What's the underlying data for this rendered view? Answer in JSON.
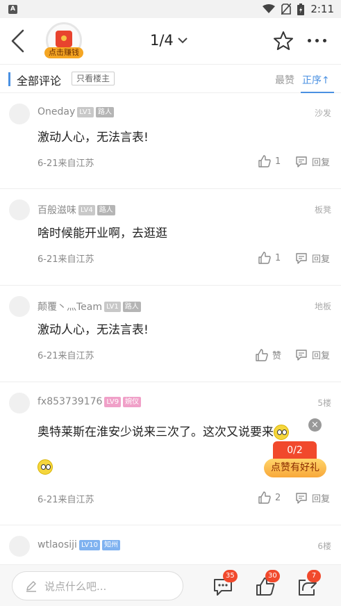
{
  "status_bar": {
    "time": "2:11",
    "app_badge": "A",
    "icons": [
      "wifi-icon",
      "no-sim-icon",
      "battery-icon"
    ]
  },
  "topbar": {
    "earn_label": "点击赚钱",
    "page_indicator": "1/4"
  },
  "filter": {
    "title": "全部评论",
    "owner_only": "只看楼主",
    "hot": "最赞",
    "order": "正序↑"
  },
  "comments": [
    {
      "user": "Oneday",
      "level": "LV1",
      "title": "路人",
      "floor": "沙发",
      "text": "激动人心，无法言表!",
      "meta": "6-21来自江苏",
      "likes": "1",
      "reply": "回复"
    },
    {
      "user": "百般滋味",
      "level": "LV4",
      "title": "路人",
      "floor": "板凳",
      "text": "啥时候能开业啊，去逛逛",
      "meta": "6-21来自江苏",
      "likes": "1",
      "reply": "回复"
    },
    {
      "user": "颠覆丶灬Team",
      "level": "LV1",
      "title": "路人",
      "floor": "地板",
      "text": "激动人心，无法言表!",
      "meta": "6-21来自江苏",
      "likes": "赞",
      "reply": "回复"
    },
    {
      "user": "fx853739176",
      "level": "LV9",
      "title": "婉仪",
      "floor": "5楼",
      "text": "奥特莱斯在淮安少说来三次了。这次又说要来",
      "meta": "6-21来自江苏",
      "likes": "2",
      "reply": "回复"
    },
    {
      "user": "wtlaosiji",
      "level": "LV10",
      "title": "知州",
      "floor": "6楼"
    }
  ],
  "promo": {
    "close": "×",
    "count": "0/2",
    "label": "点赞有好礼"
  },
  "bottom": {
    "placeholder": "说点什么吧...",
    "comments_count": "35",
    "likes_count": "30",
    "shares_count": "7"
  },
  "colors": {
    "accent": "#4a90e2",
    "badge": "#f1492c",
    "level_gray": "#c8c8c8",
    "level_pink": "#f0a0c8",
    "level_blue": "#7fb2f0"
  }
}
